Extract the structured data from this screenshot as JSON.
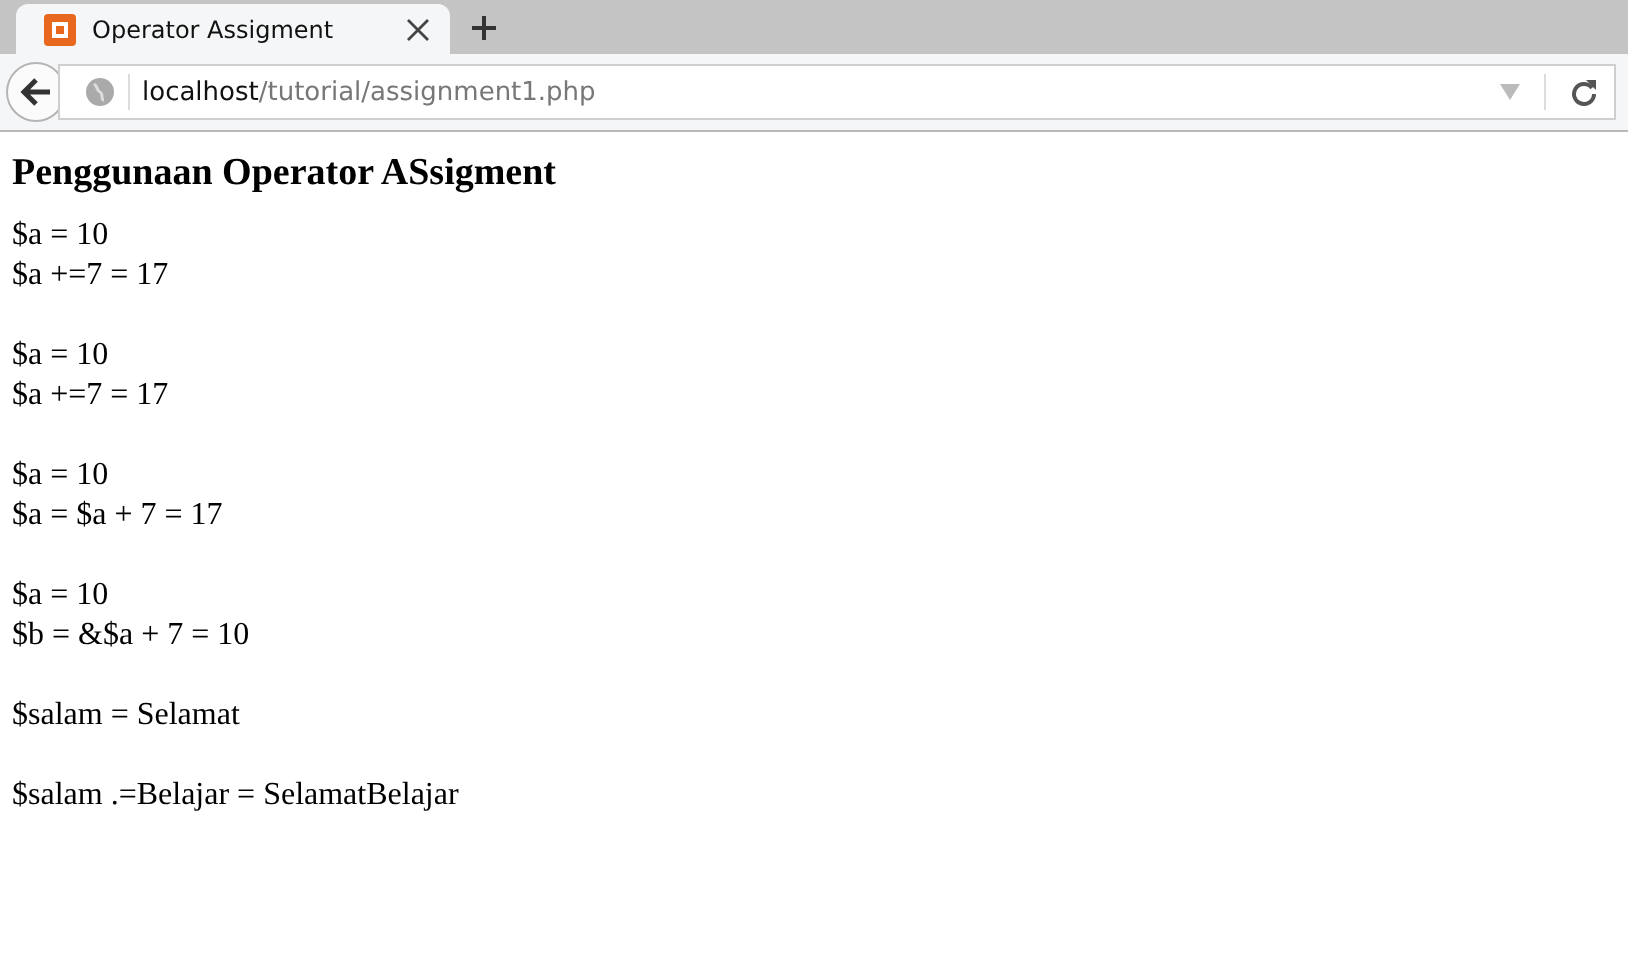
{
  "tabs": [
    {
      "title": "Operator Assigment",
      "selected": true
    }
  ],
  "url": {
    "host": "localhost",
    "path": "/tutorial/assignment1.php"
  },
  "page": {
    "heading": "Penggunaan Operator ASsigment",
    "blocks": [
      [
        "$a = 10",
        "$a +=7 = 17"
      ],
      [
        "$a = 10",
        "$a +=7 = 17"
      ],
      [
        "$a = 10",
        "$a = $a + 7 = 17"
      ],
      [
        "$a = 10",
        "$b = &$a + 7 = 10"
      ],
      [
        "$salam = Selamat"
      ],
      [
        "$salam .=Belajar = SelamatBelajar"
      ]
    ]
  }
}
